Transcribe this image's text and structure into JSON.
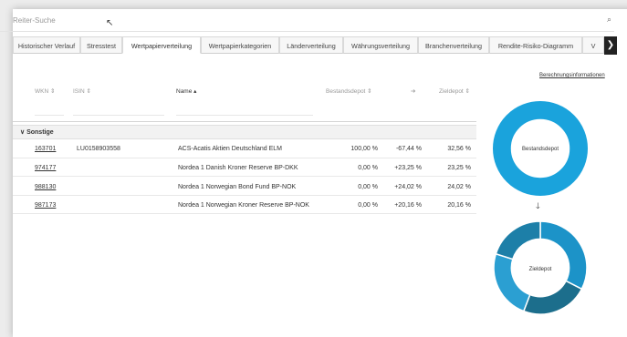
{
  "search": {
    "label": "Reiter-Suche",
    "icon": "search-icon"
  },
  "tabs": [
    {
      "label": "Historischer Verlauf",
      "active": false
    },
    {
      "label": "Stresstest",
      "active": false
    },
    {
      "label": "Wertpapierverteilung",
      "active": true
    },
    {
      "label": "Wertpapierkategorien",
      "active": false
    },
    {
      "label": "Länderverteilung",
      "active": false
    },
    {
      "label": "Währungsverteilung",
      "active": false
    },
    {
      "label": "Branchenverteilung",
      "active": false
    },
    {
      "label": "Rendite-Risiko-Diagramm",
      "active": false
    },
    {
      "label": "V",
      "active": false
    }
  ],
  "tab_scroll_icon": "chevron-right-icon",
  "calc_link": "Berechnungsinformationen",
  "table": {
    "headers": {
      "wkn": "WKN ⇕",
      "isin": "ISIN ⇕",
      "name": "Name ▴",
      "bestand": "Bestandsdepot ⇕",
      "arrow": "➔",
      "ziel": "Zieldepot ⇕"
    },
    "group": "Sonstige",
    "rows": [
      {
        "wkn": "163701",
        "isin": "LU0158903558",
        "name": "ACS-Acatis Aktien Deutschland ELM",
        "bestand": "100,00 %",
        "change": "-67,44 %",
        "ziel": "32,56 %"
      },
      {
        "wkn": "974177",
        "isin": "",
        "name": "Nordea 1 Danish Kroner Reserve BP-DKK",
        "bestand": "0,00 %",
        "change": "+23,25 %",
        "ziel": "23,25 %"
      },
      {
        "wkn": "988130",
        "isin": "",
        "name": "Nordea 1 Norwegian Bond Fund BP-NOK",
        "bestand": "0,00 %",
        "change": "+24,02 %",
        "ziel": "24,02 %"
      },
      {
        "wkn": "987173",
        "isin": "",
        "name": "Nordea 1 Norwegian Kroner Reserve BP-NOK",
        "bestand": "0,00 %",
        "change": "+20,16 %",
        "ziel": "20,16 %"
      }
    ]
  },
  "charts": {
    "bestand": {
      "label": "Bestandsdepot",
      "values": [
        100
      ],
      "colors": [
        "#1aa3dc"
      ]
    },
    "arrow": "🡓",
    "ziel": {
      "label": "Zieldepot",
      "values": [
        32.56,
        23.25,
        24.02,
        20.16
      ],
      "colors": [
        "#1c93c8",
        "#1c6e8c",
        "#2b9fd2",
        "#1d7fa8"
      ]
    }
  }
}
